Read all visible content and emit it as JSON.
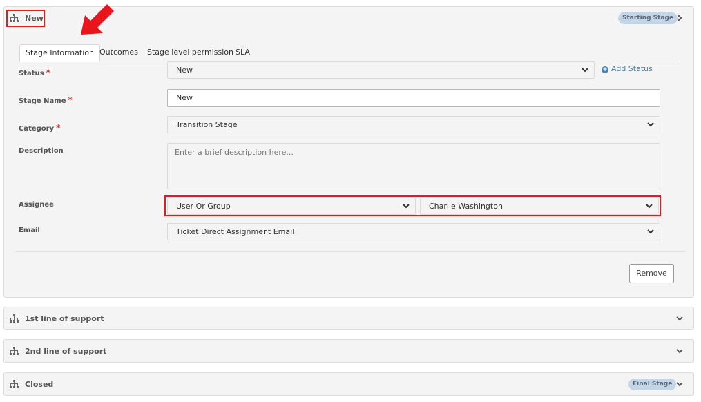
{
  "stages": [
    {
      "name": "New",
      "badge": "Starting Stage"
    },
    {
      "name": "1st line of support"
    },
    {
      "name": "2nd line of support"
    },
    {
      "name": "Closed",
      "badge": "Final Stage"
    }
  ],
  "tabs": [
    "Stage Information",
    "Outcomes",
    "Stage level permission",
    "SLA"
  ],
  "form": {
    "status_label": "Status",
    "status_value": "New",
    "add_status": "Add Status",
    "stage_name_label": "Stage Name",
    "stage_name_value": "New",
    "category_label": "Category",
    "category_value": "Transition Stage",
    "description_label": "Description",
    "description_placeholder": "Enter a brief description here...",
    "assignee_label": "Assignee",
    "assignee_type": "User Or Group",
    "assignee_value": "Charlie Washington",
    "email_label": "Email",
    "email_value": "Ticket Direct Assignment Email",
    "required_mark": "*"
  },
  "remove_label": "Remove",
  "colors": {
    "highlight": "#e21b1b",
    "accent": "#4a7fa8",
    "badge_bg": "#c5d5e8"
  }
}
